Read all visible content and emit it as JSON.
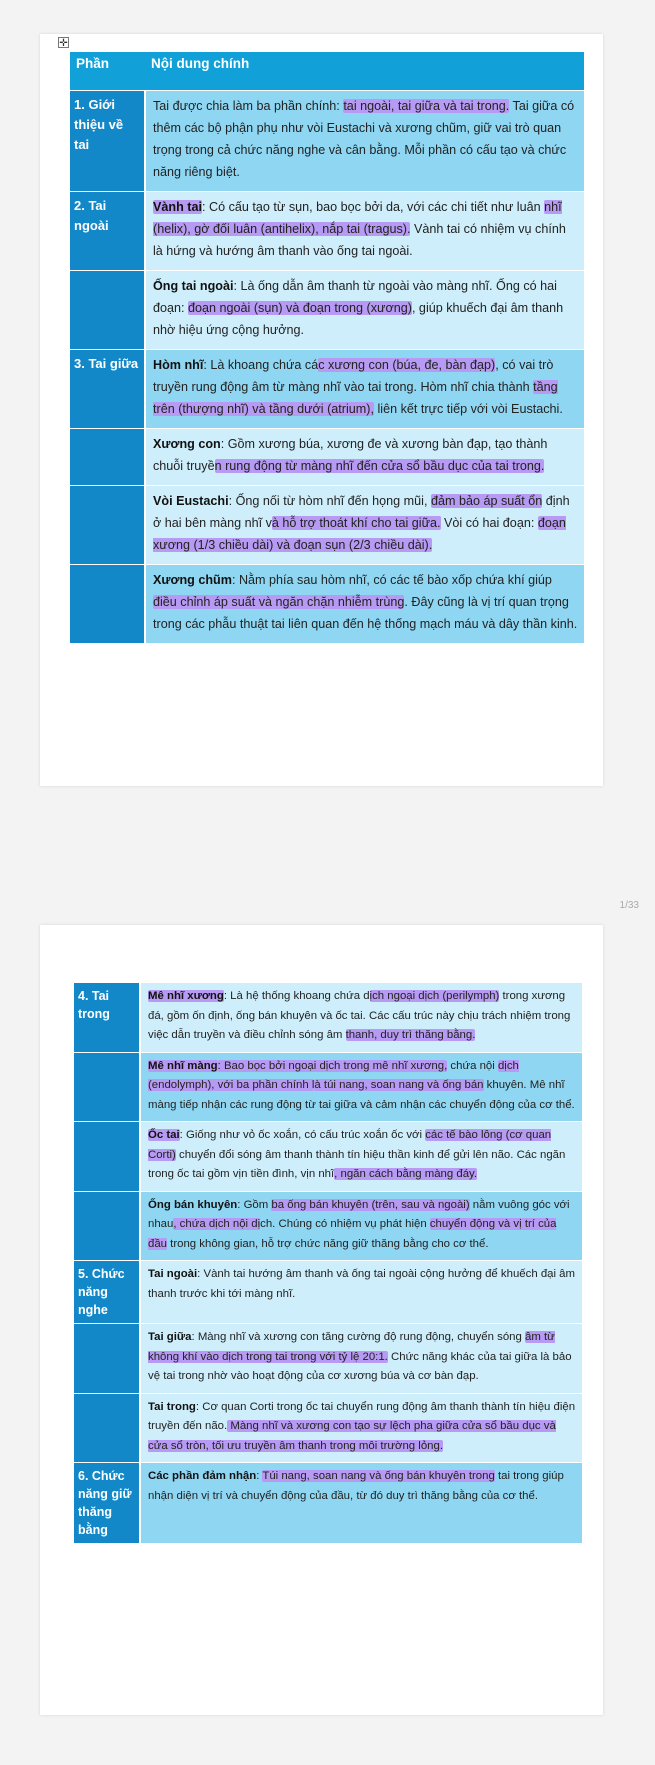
{
  "page_indicator": "1/33",
  "table1": {
    "headers": [
      "Phần",
      "Nội dung chính"
    ],
    "rows": [
      {
        "section": "1. Giới thiệu về tai",
        "tone": "dark",
        "parts": [
          {
            "t": "Tai được chia làm ba phần chính: "
          },
          {
            "t": "tai ngoài, tai giữa và tai trong.",
            "hl": true
          },
          {
            "t": " Tai giữa có thêm các bộ phận phụ như vòi Eustachi và xương chũm, giữ vai trò quan trọng trong cả chức năng nghe và cân bằng. Mỗi phần có cấu tạo và chức năng riêng biệt."
          }
        ]
      },
      {
        "section": "2. Tai ngoài",
        "tone": "light",
        "parts": [
          {
            "t": "Vành tai",
            "b": true,
            "hl": true
          },
          {
            "t": ": Có cấu tạo từ sụn, bao bọc bởi da, với các chi tiết như luân "
          },
          {
            "t": "nhĩ (helix), gờ đối luân (antihelix), nắp tai (tragus).",
            "hl": true
          },
          {
            "t": " Vành tai có nhiệm vụ chính là hứng và hướng âm thanh vào ống tai ngoài."
          }
        ]
      },
      {
        "section": "",
        "tone": "light",
        "parts": [
          {
            "t": "Ống tai ngoài",
            "b": true
          },
          {
            "t": ": Là ống dẫn âm thanh từ ngoài vào màng nhĩ. Ống có hai đoạn: "
          },
          {
            "t": "đoạn ngoài (sụn) và đoạn trong (xương)",
            "hl": true
          },
          {
            "t": ", giúp khuếch đại âm thanh nhờ hiệu ứng cộng hưởng."
          }
        ]
      },
      {
        "section": "3. Tai giữa",
        "tone": "dark",
        "parts": [
          {
            "t": "Hòm nhĩ",
            "b": true
          },
          {
            "t": ": Là khoang chứa cá"
          },
          {
            "t": "c xương con (búa, đe, bàn đạp)",
            "hl": true
          },
          {
            "t": ", có vai trò truyền rung động âm từ màng nhĩ vào tai trong. Hòm nhĩ chia thành "
          },
          {
            "t": "tầng trên (thượng nhĩ) và tầng dưới (atrium),",
            "hl": true
          },
          {
            "t": " liên kết trực tiếp với vòi Eustachi."
          }
        ]
      },
      {
        "section": "",
        "tone": "light",
        "parts": [
          {
            "t": "Xương con",
            "b": true
          },
          {
            "t": ": Gồm xương búa, xương đe và xương bàn đạp, tạo thành chuỗi truyề"
          },
          {
            "t": "n rung động từ màng nhĩ đến cửa sổ bầu dục của tai trong.",
            "hl": true
          }
        ]
      },
      {
        "section": "",
        "tone": "light",
        "parts": [
          {
            "t": "Vòi Eustachi",
            "b": true
          },
          {
            "t": ": Ống nối từ hòm nhĩ đến họng mũi, "
          },
          {
            "t": "đảm bảo áp suất ổn",
            "hl": true
          },
          {
            "t": " định ở hai bên màng nhĩ v"
          },
          {
            "t": "à hỗ trợ thoát khí cho tai giữa.",
            "hl": true
          },
          {
            "t": " Vòi có hai đoạn: "
          },
          {
            "t": "đoạn xương (1/3 chiều dài) và đoạn sụn (2/3 chiều dài).",
            "hl": true
          }
        ]
      },
      {
        "section": "",
        "tone": "dark",
        "parts": [
          {
            "t": "Xương chũm",
            "b": true
          },
          {
            "t": ": Nằm phía sau hòm nhĩ, có các tế bào xốp chứa khí giúp "
          },
          {
            "t": "điều chỉnh áp suất và ngăn chặn nhiễm trùng",
            "hl": true
          },
          {
            "t": ". Đây cũng là vị trí quan trọng trong các phẫu thuật tai liên quan đến hệ thống mạch máu và dây thần kinh."
          }
        ]
      }
    ]
  },
  "table2": {
    "rows": [
      {
        "section": "4. Tai trong",
        "tone": "light",
        "parts": [
          {
            "t": "Mê nhĩ xương",
            "b": true,
            "hl": true
          },
          {
            "t": ": Là hệ thống khoang chứa d"
          },
          {
            "t": "ịch ngoại dịch (perilymph)",
            "hl": true
          },
          {
            "t": " trong xương đá, gồm ốn định, ống bán khuyên và ốc tai. Các cấu trúc này chịu trách nhiệm trong việc dẫn truyền và điều chỉnh sóng âm "
          },
          {
            "t": "thanh, duy trì thăng bằng.",
            "hl": true
          }
        ]
      },
      {
        "section": "",
        "tone": "dark",
        "parts": [
          {
            "t": "Mê nhĩ màng",
            "b": true,
            "hl": true
          },
          {
            "t": ": Bao bọc bởi ngoại dịch trong mê nhĩ xương,",
            "hl": true
          },
          {
            "t": " chứa nội "
          },
          {
            "t": "dịch (endolymph), với ba phần chính l",
            "hl": true
          },
          {
            "t": "à túi nang, soan nang và ống bán",
            "hl": true
          },
          {
            "t": " khuyên. Mê nhĩ màng tiếp nhận các rung động từ tai giữa và cảm nhận các chuyển động của cơ thể."
          }
        ]
      },
      {
        "section": "",
        "tone": "light",
        "parts": [
          {
            "t": "Ốc tai",
            "b": true,
            "hl": true
          },
          {
            "t": ": Giống như vỏ ốc xoắn, có cấu trúc xoắn ốc với "
          },
          {
            "t": "các tế bào lông (cơ quan Corti)",
            "hl": true
          },
          {
            "t": " chuyển đổi sóng âm thanh thành tín hiệu thần kinh để gửi lên não. Các ngăn trong ốc tai gồm vịn tiền đình, vịn nhĩ"
          },
          {
            "t": ", ngăn cách bằng màng đáy.",
            "hl": true
          }
        ]
      },
      {
        "section": "",
        "tone": "dark",
        "parts": [
          {
            "t": "Ống bán khuyên",
            "b": true
          },
          {
            "t": ": Gồm "
          },
          {
            "t": "ba ống bán khuyên (trên, sau và ngoài)",
            "hl": true
          },
          {
            "t": " nằm vuông góc với nhau"
          },
          {
            "t": ", chứa dịch nội dị",
            "hl": true
          },
          {
            "t": "ch. Chúng có nhiệm vụ phát hiện "
          },
          {
            "t": "chuyển động và vị trí của đầu",
            "hl": true
          },
          {
            "t": " trong không gian, hỗ trợ chức năng giữ thăng bằng cho cơ thể."
          }
        ]
      },
      {
        "section": "5. Chức năng nghe",
        "tone": "light",
        "parts": [
          {
            "t": "Tai ngoài",
            "b": true
          },
          {
            "t": ": Vành tai hướng âm thanh và ống tai ngoài cộng hưởng để khuếch đại âm thanh trước khi tới màng nhĩ."
          }
        ]
      },
      {
        "section": "",
        "tone": "light",
        "parts": [
          {
            "t": "Tai giữa",
            "b": true
          },
          {
            "t": ": Màng nhĩ và xương con tăng cường độ rung động, chuyển sóng "
          },
          {
            "t": "âm từ không khí vào dịch trong tai trong với tỷ lệ 20:1.",
            "hl": true
          },
          {
            "t": " Chức năng khác của tai giữa là bảo vệ tai trong nhờ vào hoạt động của cơ xương búa và cơ bàn đạp."
          }
        ]
      },
      {
        "section": "",
        "tone": "light",
        "parts": [
          {
            "t": "Tai trong",
            "b": true
          },
          {
            "t": ": Cơ quan Corti trong ốc tai chuyển rung động âm thanh thành tín hiệu điện truyền đến não."
          },
          {
            "t": " Màng nhĩ và xương con tạo sự lệch pha giữa cửa sổ bầu dục và cửa sổ tròn, tối ưu truyền âm thanh trong môi trường lỏng.",
            "hl": true
          }
        ]
      },
      {
        "section": "6. Chức năng giữ thăng bằng",
        "tone": "dark",
        "parts": [
          {
            "t": "Các phần đảm nhận",
            "b": true
          },
          {
            "t": ": "
          },
          {
            "t": "Túi nang, soan nang và ống bán khuyên trong",
            "hl": true
          },
          {
            "t": " tai trong giúp nhận diện vị trí và chuyển động của đầu, từ đó duy trì thăng bằng của cơ thể."
          }
        ]
      }
    ]
  }
}
